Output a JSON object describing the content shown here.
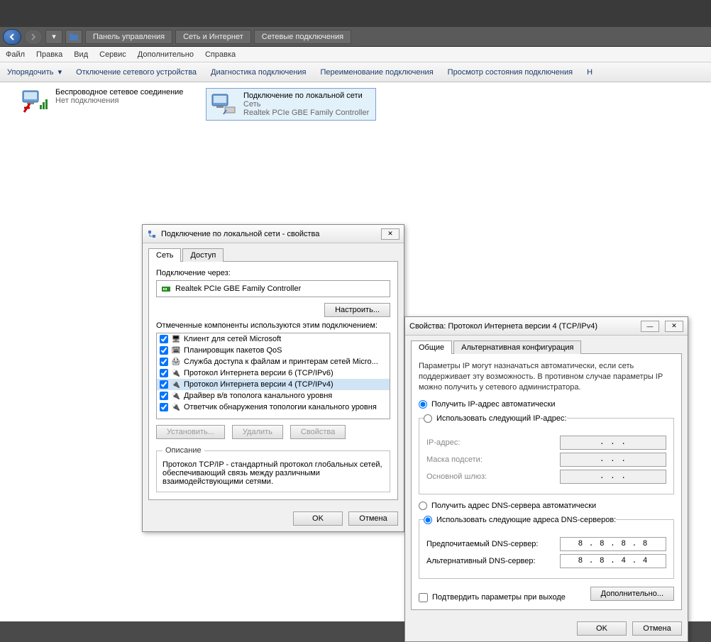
{
  "breadcrumb": {
    "b1": "Панель управления",
    "b2": "Сеть и Интернет",
    "b3": "Сетевые подключения"
  },
  "menu": {
    "file": "Файл",
    "edit": "Правка",
    "view": "Вид",
    "tools": "Сервис",
    "advanced": "Дополнительно",
    "help": "Справка"
  },
  "toolbar": {
    "organize": "Упорядочить",
    "disable": "Отключение сетевого устройства",
    "diagnose": "Диагностика подключения",
    "rename": "Переименование подключения",
    "status": "Просмотр состояния подключения",
    "more": "Н"
  },
  "conn": {
    "wireless": {
      "title": "Беспроводное сетевое соединение",
      "status": "Нет подключения"
    },
    "lan": {
      "title": "Подключение по локальной сети",
      "net": "Сеть",
      "device": "Realtek PCIe GBE Family Controller"
    }
  },
  "dlg1": {
    "title": "Подключение по локальной сети - свойства",
    "tab_net": "Сеть",
    "tab_access": "Доступ",
    "conn_via": "Подключение через:",
    "adapter": "Realtek PCIe GBE Family Controller",
    "configure": "Настроить...",
    "checked_label": "Отмеченные компоненты используются этим подключением:",
    "items": [
      "Клиент для сетей Microsoft",
      "Планировщик пакетов QoS",
      "Служба доступа к файлам и принтерам сетей Micro...",
      "Протокол Интернета версии 6 (TCP/IPv6)",
      "Протокол Интернета версии 4 (TCP/IPv4)",
      "Драйвер в/в тополога канального уровня",
      "Ответчик обнаружения топологии канального уровня"
    ],
    "install": "Установить...",
    "remove": "Удалить",
    "properties": "Свойства",
    "desc_title": "Описание",
    "desc": "Протокол TCP/IP - стандартный протокол глобальных сетей, обеспечивающий связь между различными взаимодействующими сетями.",
    "ok": "OK",
    "cancel": "Отмена"
  },
  "dlg2": {
    "title": "Свойства: Протокол Интернета версии 4 (TCP/IPv4)",
    "tab_general": "Общие",
    "tab_alt": "Альтернативная конфигурация",
    "info": "Параметры IP могут назначаться автоматически, если сеть поддерживает эту возможность. В противном случае параметры IP можно получить у сетевого администратора.",
    "radio_auto_ip": "Получить IP-адрес автоматически",
    "radio_manual_ip": "Использовать следующий IP-адрес:",
    "ip_addr": "IP-адрес:",
    "mask": "Маска подсети:",
    "gw": "Основной шлюз:",
    "radio_auto_dns": "Получить адрес DNS-сервера автоматически",
    "radio_manual_dns": "Использовать следующие адреса DNS-серверов:",
    "pref_dns": "Предпочитаемый DNS-сервер:",
    "alt_dns": "Альтернативный DNS-сервер:",
    "dns1": "8 . 8 . 8 . 8",
    "dns2": "8 . 8 . 4 . 4",
    "confirm": "Подтвердить параметры при выходе",
    "advanced": "Дополнительно...",
    "ok": "OK",
    "cancel": "Отмена",
    "dots": ".   .   ."
  }
}
